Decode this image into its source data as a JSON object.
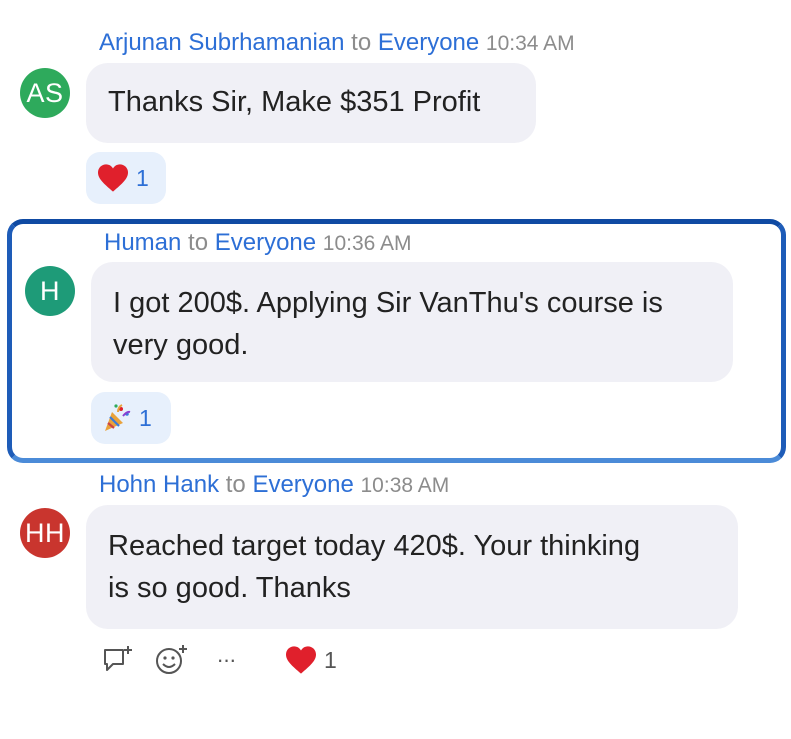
{
  "messages": [
    {
      "sender": "Arjunan Subrhamanian",
      "to_word": "to",
      "recipient": "Everyone",
      "time": "10:34 AM",
      "avatar_initials": "AS",
      "avatar_color": "#2eaa5c",
      "text": "Thanks Sir, Make $351 Profit",
      "reaction": {
        "icon": "heart-icon",
        "count": "1"
      }
    },
    {
      "sender": "Human",
      "to_word": "to",
      "recipient": "Everyone",
      "time": "10:36 AM",
      "avatar_initials": "H",
      "avatar_color": "#1e9b78",
      "text_line1": "I got 200$. Applying Sir VanThu's course is",
      "text_line2": "very good.",
      "reaction": {
        "icon": "party-popper-icon",
        "count": "1"
      }
    },
    {
      "sender": "Hohn Hank",
      "to_word": "to",
      "recipient": "Everyone",
      "time": "10:38 AM",
      "avatar_initials": "HH",
      "avatar_color": "#c9352e",
      "text_line1": "Reached target today 420$. Your thinking",
      "text_line2": "is so good. Thanks",
      "reaction": {
        "icon": "heart-icon",
        "count": "1"
      }
    }
  ],
  "actions": [
    {
      "icon": "reply-icon"
    },
    {
      "icon": "add-reaction-icon"
    },
    {
      "icon": "more-icon",
      "glyph": "···"
    }
  ],
  "colors": {
    "accent": "#2d6fd6",
    "highlight_border": "#0f4aa3",
    "bubble": "#f0f0f6"
  }
}
